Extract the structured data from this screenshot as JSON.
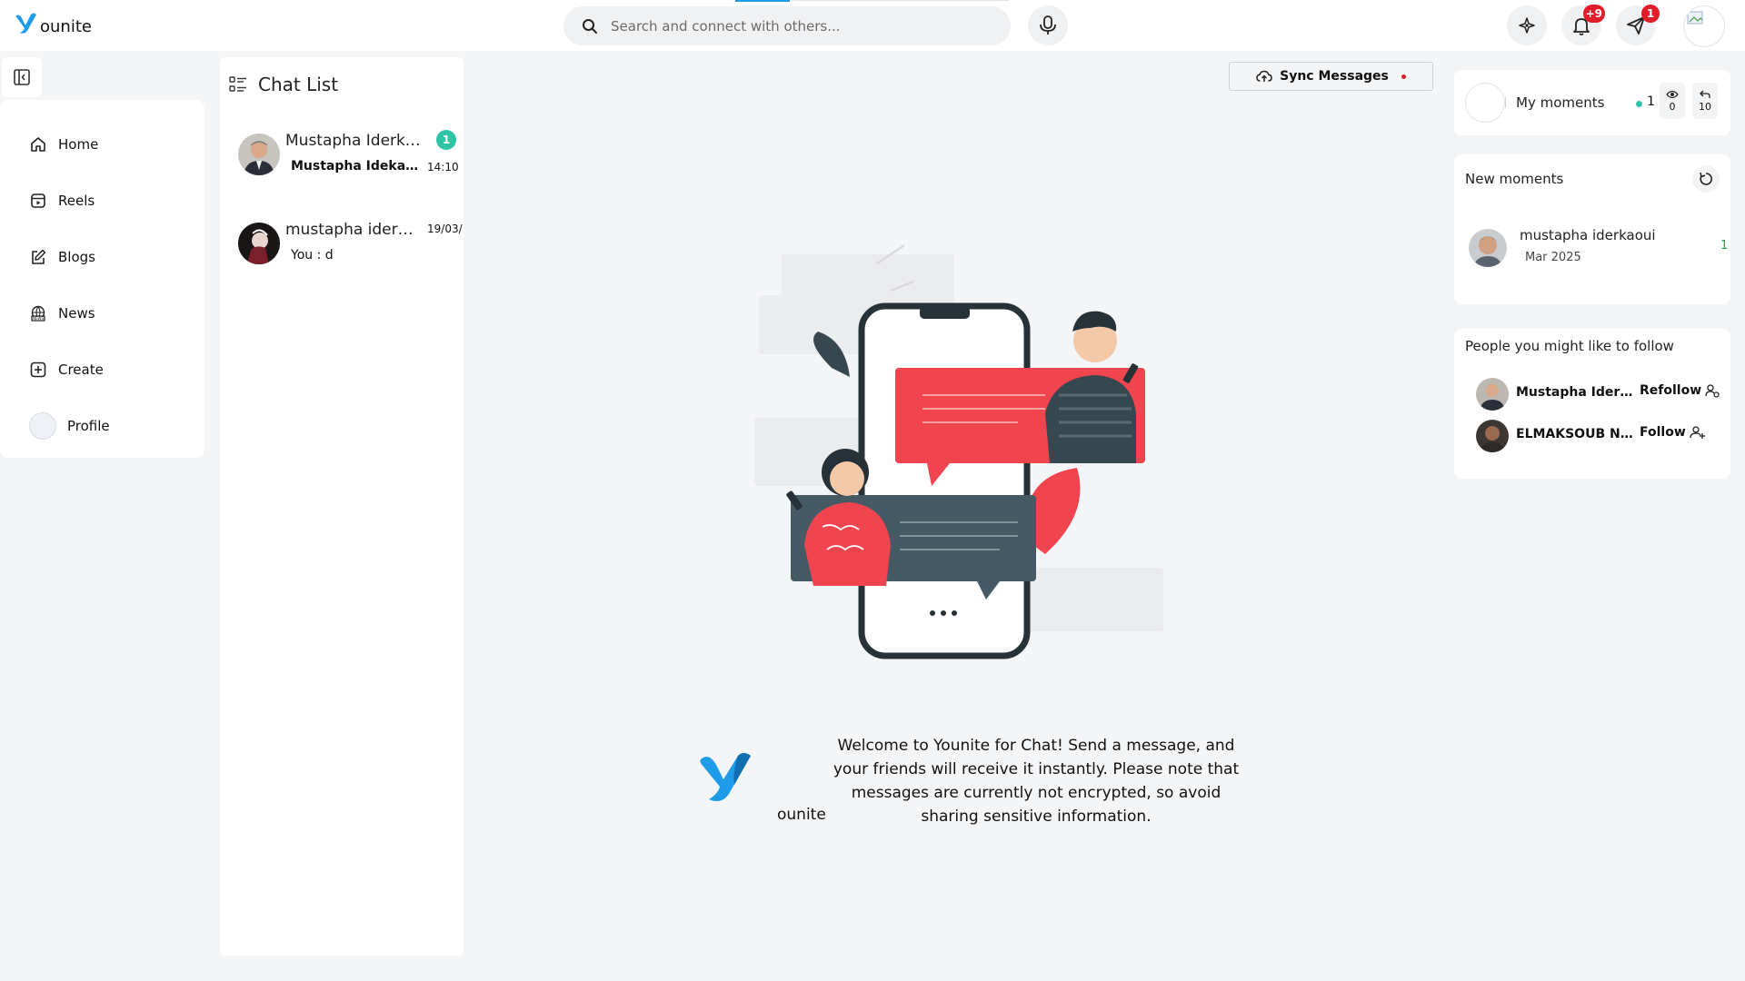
{
  "brand": {
    "name": "ounite",
    "logo_color": "#1e9be9"
  },
  "search": {
    "placeholder": "Search and connect with others..."
  },
  "header": {
    "notifications_badge": "+9",
    "messages_badge": "1",
    "icons": [
      "ai-sparkle-icon",
      "bell-icon",
      "send-icon",
      "mic-icon",
      "search-icon"
    ]
  },
  "sidebar": {
    "items": [
      {
        "label": "Home",
        "icon": "home-icon"
      },
      {
        "label": "Reels",
        "icon": "reels-icon"
      },
      {
        "label": "Blogs",
        "icon": "blog-edit-icon"
      },
      {
        "label": "News",
        "icon": "news-icon"
      },
      {
        "label": "Create",
        "icon": "plus-square-icon"
      },
      {
        "label": "Profile",
        "icon": "avatar"
      }
    ]
  },
  "chat_list": {
    "title": "Chat List",
    "items": [
      {
        "name": "Mustapha Iderkaoui",
        "preview": "Mustapha Idekaoui",
        "time": "14:10",
        "unread": "1"
      },
      {
        "name": "mustapha iderkaoui",
        "preview": "You : d",
        "time": "19/03/"
      }
    ]
  },
  "main": {
    "sync_label": "Sync Messages",
    "welcome_brand": "ounite",
    "welcome_text": "Welcome to Younite for Chat! Send a message, and your friends will receive it instantly. Please note that messages are currently not encrypted, so avoid sharing sensitive information."
  },
  "moments": {
    "my_label": "My moments",
    "my_count": "1",
    "views": "0",
    "shares": "10"
  },
  "new_moments": {
    "title": "New moments",
    "items": [
      {
        "name": "mustapha iderkaoui",
        "date": "Mar 2025",
        "count": "1"
      }
    ]
  },
  "follow": {
    "title": "People you might like to follow",
    "items": [
      {
        "name": "Mustapha Iderkaoui",
        "action": "Refollow"
      },
      {
        "name": "ELMAKSOUB NOUREDDINE",
        "action": "Follow"
      }
    ]
  },
  "colors": {
    "accent": "#1e9be9",
    "badge": "#e11d2a",
    "teal": "#2ec4a5",
    "coral": "#f0444f",
    "dark": "#37474f"
  }
}
